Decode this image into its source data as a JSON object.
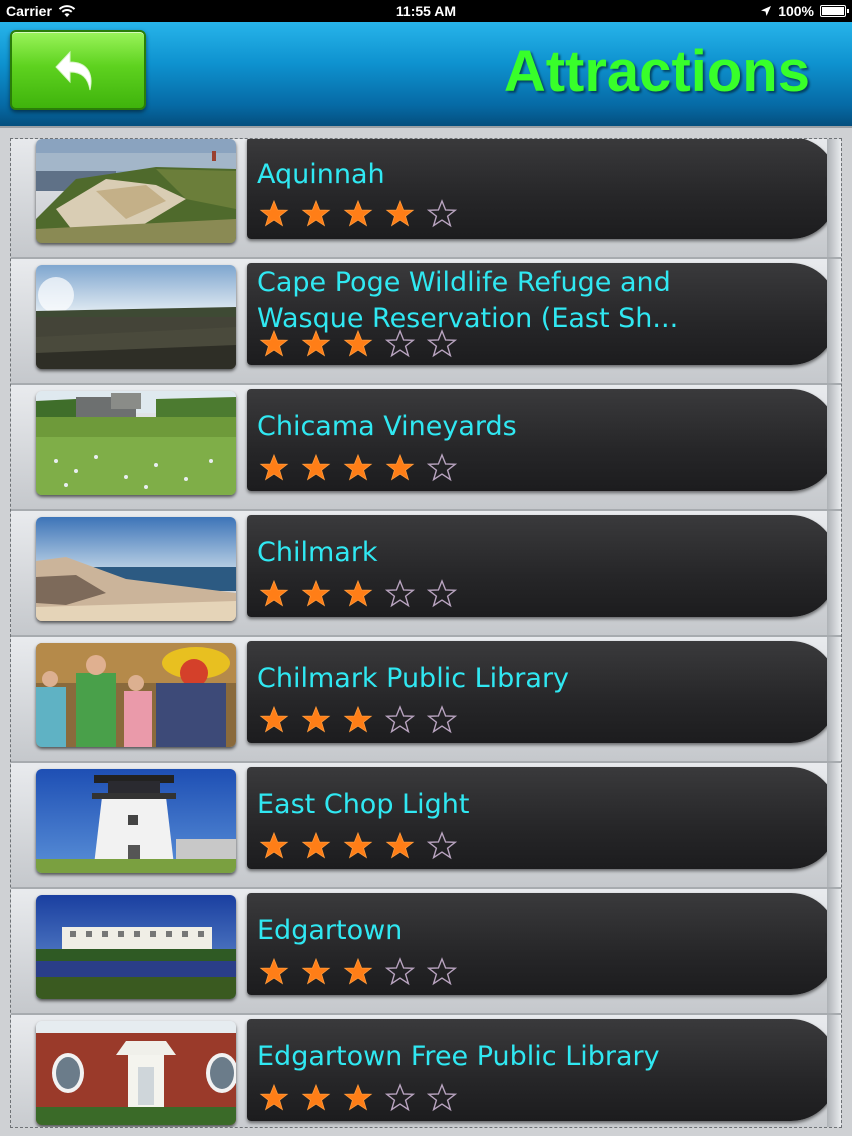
{
  "status_bar": {
    "carrier": "Carrier",
    "time": "11:55 AM",
    "battery": "100%"
  },
  "header": {
    "title": "Attractions",
    "back_icon": "back-arrow-icon"
  },
  "colors": {
    "title_green": "#38ff2a",
    "item_title_cyan": "#30e8f2",
    "star_filled": "#ff7e17",
    "star_empty_outline": "#b9a4c0"
  },
  "attractions": [
    {
      "name": "Aquinnah",
      "rating": 4,
      "max_rating": 5,
      "image": "cliffs-photo"
    },
    {
      "name": "Cape Poge Wildlife Refuge and",
      "name_line2": "Wasque Reservation (East Sh...",
      "rating": 3,
      "max_rating": 5,
      "image": "marsh-photo"
    },
    {
      "name": "Chicama Vineyards",
      "rating": 4,
      "max_rating": 5,
      "image": "meadow-photo"
    },
    {
      "name": "Chilmark",
      "rating": 3,
      "max_rating": 5,
      "image": "beach-photo"
    },
    {
      "name": "Chilmark Public Library",
      "rating": 3,
      "max_rating": 5,
      "image": "people-photo"
    },
    {
      "name": "East Chop Light",
      "rating": 4,
      "max_rating": 5,
      "image": "lighthouse-photo"
    },
    {
      "name": "Edgartown",
      "rating": 3,
      "max_rating": 5,
      "image": "hotel-photo"
    },
    {
      "name": "Edgartown Free Public Library",
      "rating": 3,
      "max_rating": 5,
      "image": "library-photo"
    }
  ]
}
